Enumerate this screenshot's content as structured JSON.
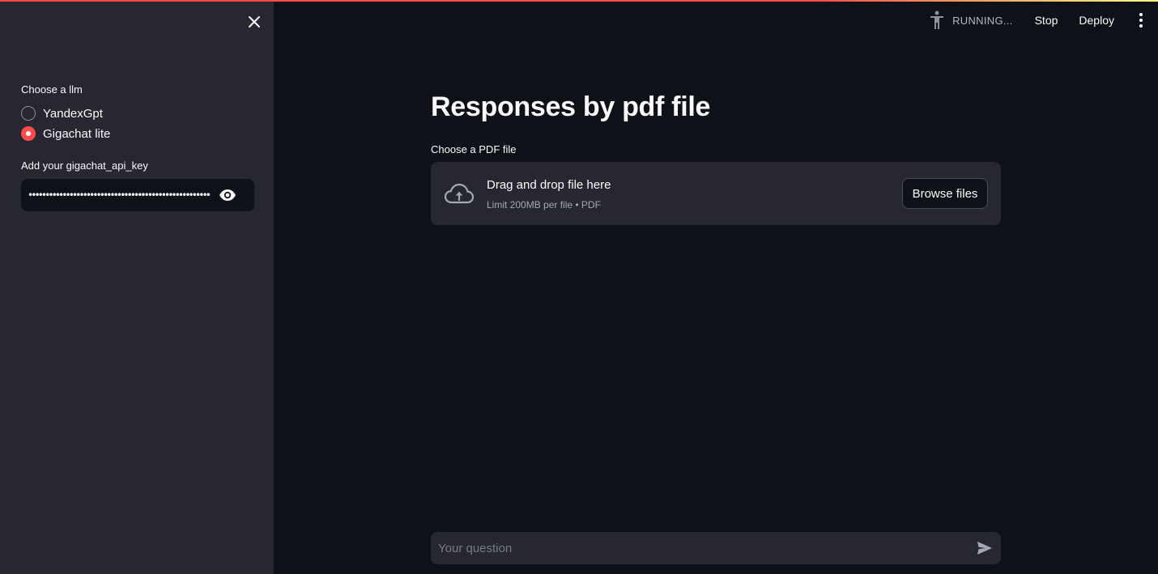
{
  "sidebar": {
    "llm_label": "Choose a llm",
    "llm_options": [
      {
        "label": "YandexGpt",
        "selected": false
      },
      {
        "label": "Gigachat lite",
        "selected": true
      }
    ],
    "api_key_label": "Add your gigachat_api_key",
    "api_key_value": "••••••••••••••••••••••••••••••••••••••••••••••••••••••••••••••••••",
    "icons": {
      "close": "close-icon",
      "visibility": "eye-icon"
    }
  },
  "header": {
    "status": "RUNNING...",
    "stop_label": "Stop",
    "deploy_label": "Deploy",
    "icons": {
      "running": "running-man-icon",
      "menu": "kebab-menu-icon"
    }
  },
  "main": {
    "title": "Responses by pdf file",
    "uploader": {
      "label": "Choose a PDF file",
      "drop_text": "Drag and drop file here",
      "limit_text": "Limit 200MB per file • PDF",
      "browse_label": "Browse files",
      "icon": "cloud-upload-icon"
    },
    "chat": {
      "placeholder": "Your question",
      "icon": "send-icon"
    }
  },
  "colors": {
    "accent": "#ff4b4b",
    "background": "#0e1117",
    "sidebar": "#262730",
    "text": "#fafafa"
  }
}
